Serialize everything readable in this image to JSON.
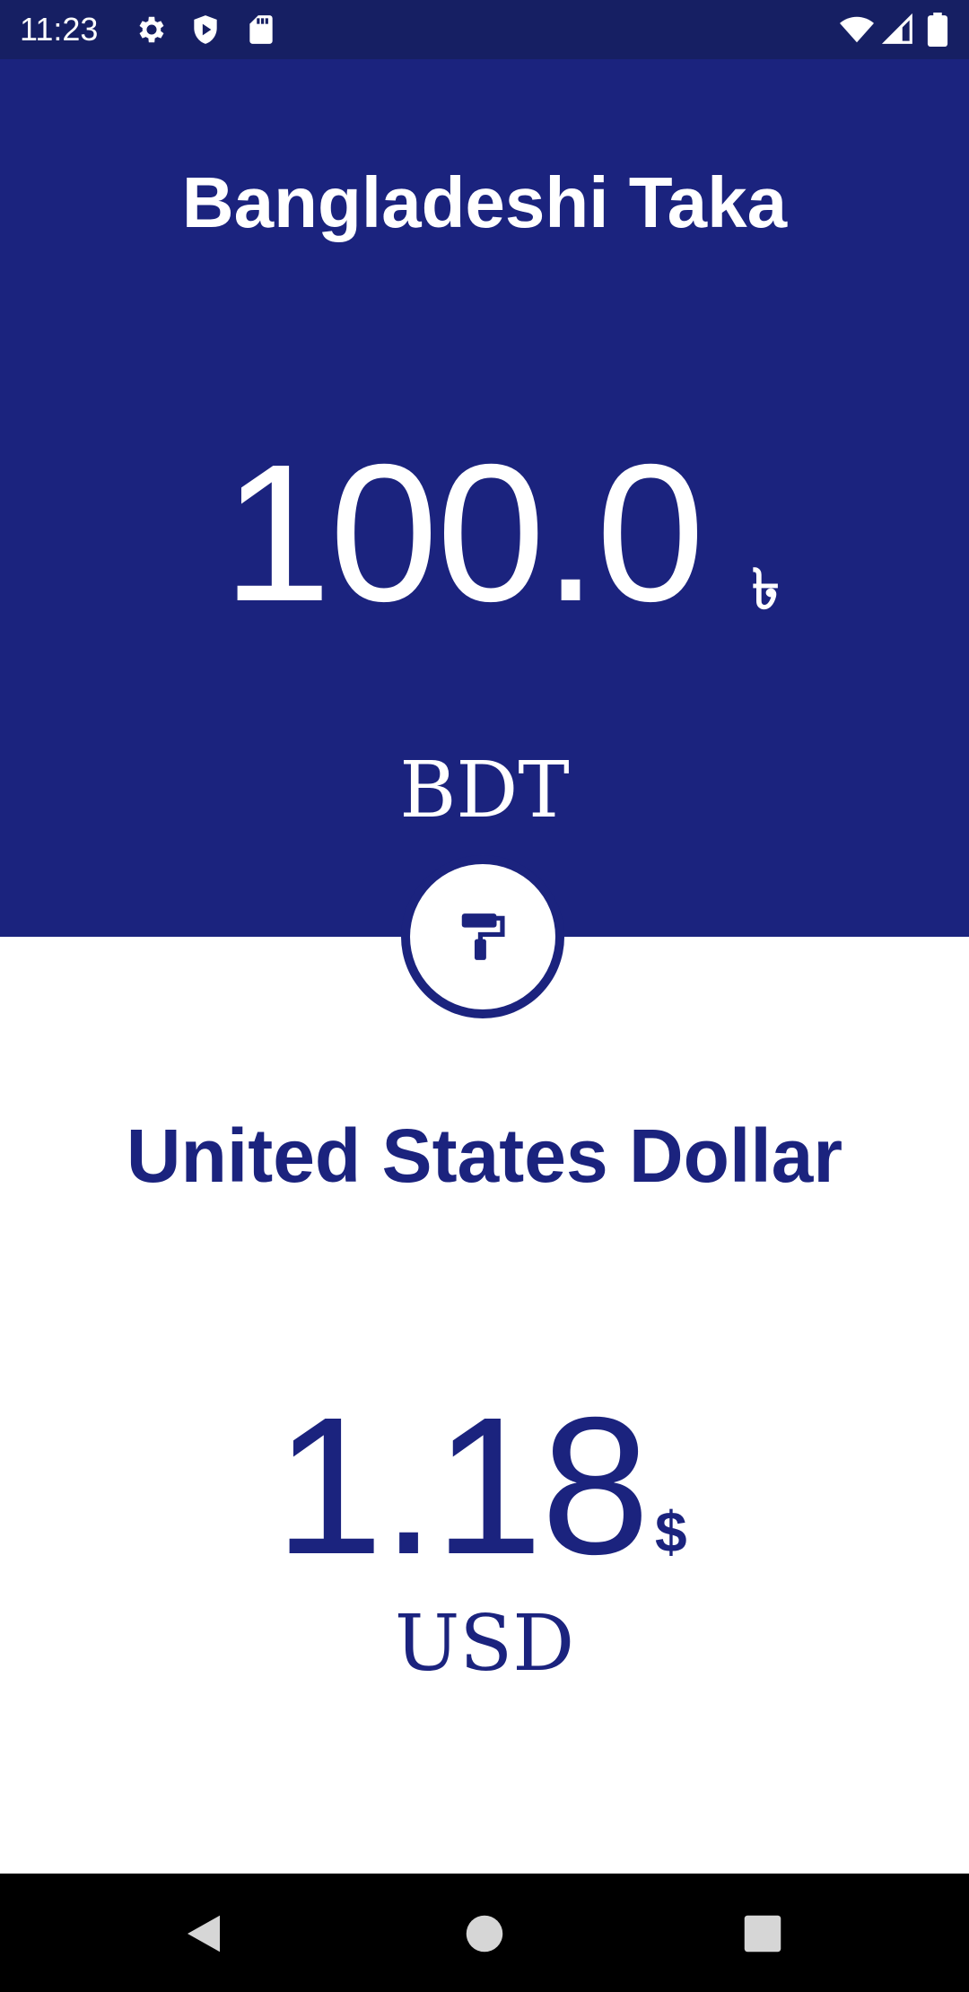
{
  "status_bar": {
    "time": "11:23",
    "icons": [
      "settings-icon",
      "shield-icon",
      "sd-card-icon",
      "wifi-icon",
      "signal-icon",
      "battery-icon"
    ]
  },
  "from_currency": {
    "name": "Bangladeshi Taka",
    "amount": "100.0",
    "symbol": "৳",
    "code": "BDT"
  },
  "swap_button": {
    "icon": "paint-roller-icon"
  },
  "to_currency": {
    "name": "United States Dollar",
    "amount": "1.18",
    "symbol": "$",
    "code": "USD"
  },
  "nav_bar": {
    "icons": [
      "back-icon",
      "home-icon",
      "recents-icon"
    ]
  },
  "colors": {
    "status_bar": "#161f63",
    "primary": "#1b237e",
    "background": "#ffffff",
    "nav_bar": "#000000"
  }
}
